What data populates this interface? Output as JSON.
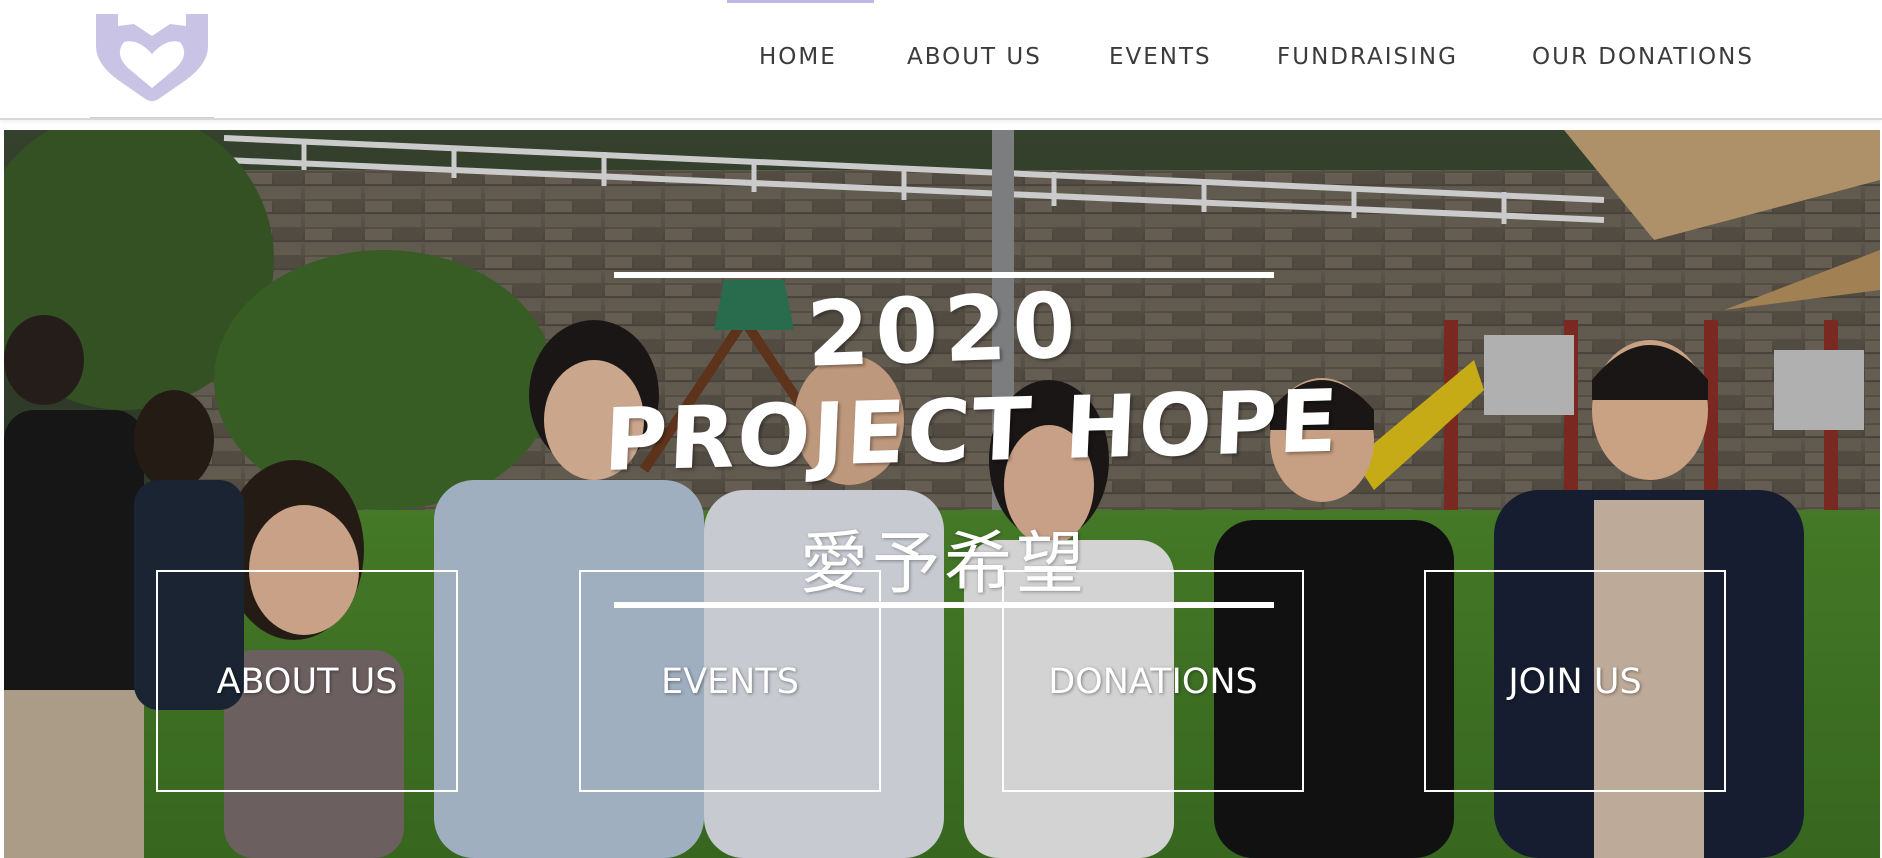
{
  "site": {
    "logo_icon": "heart-hands-icon",
    "brand_color": "#c9c3e6"
  },
  "nav": {
    "items": [
      {
        "label": "HOME",
        "active": true
      },
      {
        "label": "ABOUT US",
        "active": false
      },
      {
        "label": "EVENTS",
        "active": false
      },
      {
        "label": "FUNDRAISING",
        "active": false
      },
      {
        "label": "OUR DONATIONS",
        "active": false
      }
    ],
    "active_indicator_color": "#bfb8e4"
  },
  "hero": {
    "year": "2020",
    "title": "PROJECT HOPE",
    "subtitle_chinese": "愛予希望",
    "buttons": [
      {
        "label": "ABOUT US"
      },
      {
        "label": "EVENTS"
      },
      {
        "label": "DONATIONS"
      },
      {
        "label": "JOIN US"
      }
    ]
  }
}
